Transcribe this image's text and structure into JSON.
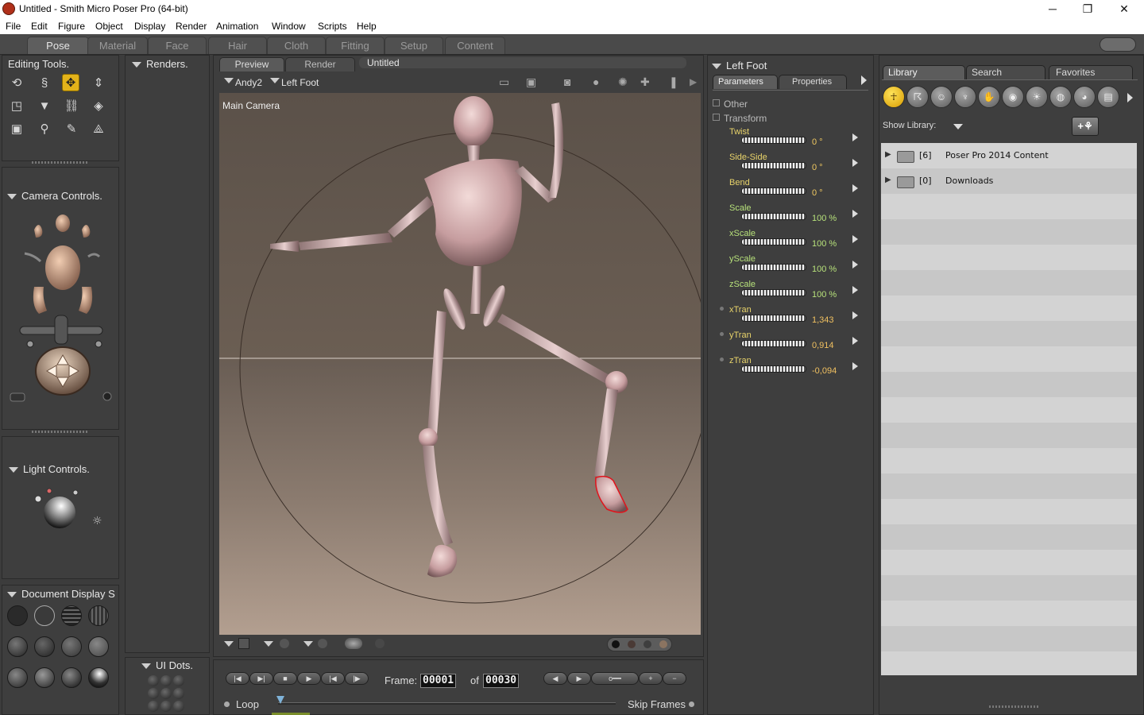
{
  "window": {
    "title": "Untitled - Smith Micro Poser Pro  (64-bit)",
    "minimize": "─",
    "restore": "❐",
    "close": "✕"
  },
  "menu": [
    "File",
    "Edit",
    "Figure",
    "Object",
    "Display",
    "Render",
    "Animation",
    "Window",
    "Scripts",
    "Help"
  ],
  "rooms": [
    "Pose",
    "Material",
    "Face",
    "Hair",
    "Cloth",
    "Fitting",
    "Setup",
    "Content"
  ],
  "active_room": "Pose",
  "editing_tools": {
    "title": "Editing Tools.",
    "tools": [
      "rotate-icon",
      "twist-icon",
      "translate-icon",
      "translate-in-out-icon",
      "scale-icon",
      "taper-icon",
      "chain-break-icon",
      "color-icon",
      "grouping-icon",
      "view-magnifier-icon",
      "morphing-tool-icon",
      "direct-manipulation-icon"
    ]
  },
  "renders_panel": {
    "title": "Renders."
  },
  "camera_controls": {
    "title": "Camera Controls."
  },
  "light_controls": {
    "title": "Light Controls."
  },
  "document_display": {
    "title": "Document Display S"
  },
  "ui_dots": {
    "title": "UI Dots."
  },
  "document": {
    "tabs": [
      "Preview",
      "Render"
    ],
    "active_tab": "Preview",
    "doc_title": "Untitled",
    "figure": "Andy2",
    "actor": "Left Foot",
    "camera_label": "Main Camera"
  },
  "parameters_panel": {
    "actor": "Left Foot",
    "tabs": [
      "Parameters",
      "Properties"
    ],
    "groups": [
      "Other",
      "Transform"
    ],
    "params": [
      {
        "name": "Twist",
        "value": "0 °",
        "kind": "rotate"
      },
      {
        "name": "Side-Side",
        "value": "0 °",
        "kind": "rotate"
      },
      {
        "name": "Bend",
        "value": "0 °",
        "kind": "rotate"
      },
      {
        "name": "Scale",
        "value": "100 %",
        "kind": "scale"
      },
      {
        "name": "xScale",
        "value": "100 %",
        "kind": "scale"
      },
      {
        "name": "yScale",
        "value": "100 %",
        "kind": "scale"
      },
      {
        "name": "zScale",
        "value": "100 %",
        "kind": "scale"
      },
      {
        "name": "xTran",
        "value": "1,343",
        "kind": "trans"
      },
      {
        "name": "yTran",
        "value": "0,914",
        "kind": "trans"
      },
      {
        "name": "zTran",
        "value": "-0,094",
        "kind": "trans"
      }
    ]
  },
  "library": {
    "tabs": [
      "Library",
      "Search",
      "Favorites"
    ],
    "show_library_label": "Show Library:",
    "items": [
      {
        "count": "[6]",
        "name": "Poser Pro 2014 Content"
      },
      {
        "count": "[0]",
        "name": "Downloads"
      }
    ]
  },
  "timeline": {
    "frame_label": "Frame:",
    "current_frame": "00001",
    "of_label": "of",
    "total_frames": "00030",
    "loop_label": "Loop",
    "skip_frames_label": "Skip Frames"
  },
  "colors": {
    "accent": "#e3b31a",
    "param_name": "#e8d36a",
    "rotate_value": "#f0c860",
    "scale_value": "#b6e07a",
    "trans_value": "#f0c060"
  }
}
